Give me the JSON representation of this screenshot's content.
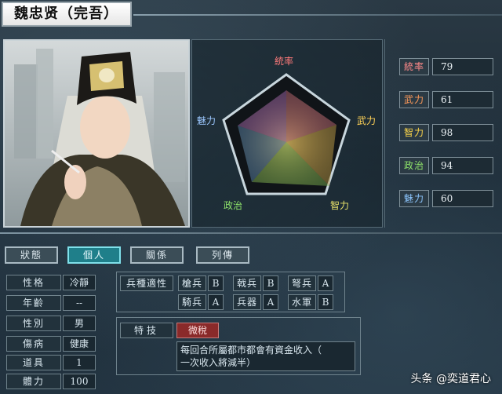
{
  "header": {
    "title": "魏忠贤（完吾）"
  },
  "radar": {
    "labels": {
      "lead": "統率",
      "war": "武力",
      "int": "智力",
      "pol": "政治",
      "chr": "魅力"
    },
    "colors": {
      "lead": "#ff7a7a",
      "war": "#ffd257",
      "int": "#e9e36a",
      "pol": "#8ee36b",
      "chr": "#9cc8ff"
    }
  },
  "stats": [
    {
      "label": "統率",
      "value": "79",
      "color": "#ff8a8a"
    },
    {
      "label": "武力",
      "value": "61",
      "color": "#ff9a5a"
    },
    {
      "label": "智力",
      "value": "98",
      "color": "#ffd84a"
    },
    {
      "label": "政治",
      "value": "94",
      "color": "#8fe46a"
    },
    {
      "label": "魅力",
      "value": "60",
      "color": "#8cc6ff"
    }
  ],
  "tabs": [
    "狀態",
    "個人",
    "關係",
    "列傳"
  ],
  "personal": [
    {
      "label": "性格",
      "value": "冷靜"
    },
    {
      "label": "年齡",
      "value": "--"
    },
    {
      "label": "性別",
      "value": "男"
    },
    {
      "label": "傷病",
      "value": "健康"
    },
    {
      "label": "道具",
      "value": "1"
    },
    {
      "label": "體力",
      "value": "100"
    }
  ],
  "troops": {
    "header": "兵種適性",
    "rows": [
      [
        {
          "label": "槍兵",
          "grade": "B"
        },
        {
          "label": "戟兵",
          "grade": "B"
        },
        {
          "label": "弩兵",
          "grade": "A"
        }
      ],
      [
        {
          "label": "騎兵",
          "grade": "A"
        },
        {
          "label": "兵器",
          "grade": "A"
        },
        {
          "label": "水軍",
          "grade": "B"
        }
      ]
    ]
  },
  "skill": {
    "header": "特技",
    "name": "微稅",
    "description_line1": "每回合所屬都市都會有資金收入（",
    "description_line2": "一次收入將減半）"
  },
  "watermark": "头条 @奕道君心"
}
